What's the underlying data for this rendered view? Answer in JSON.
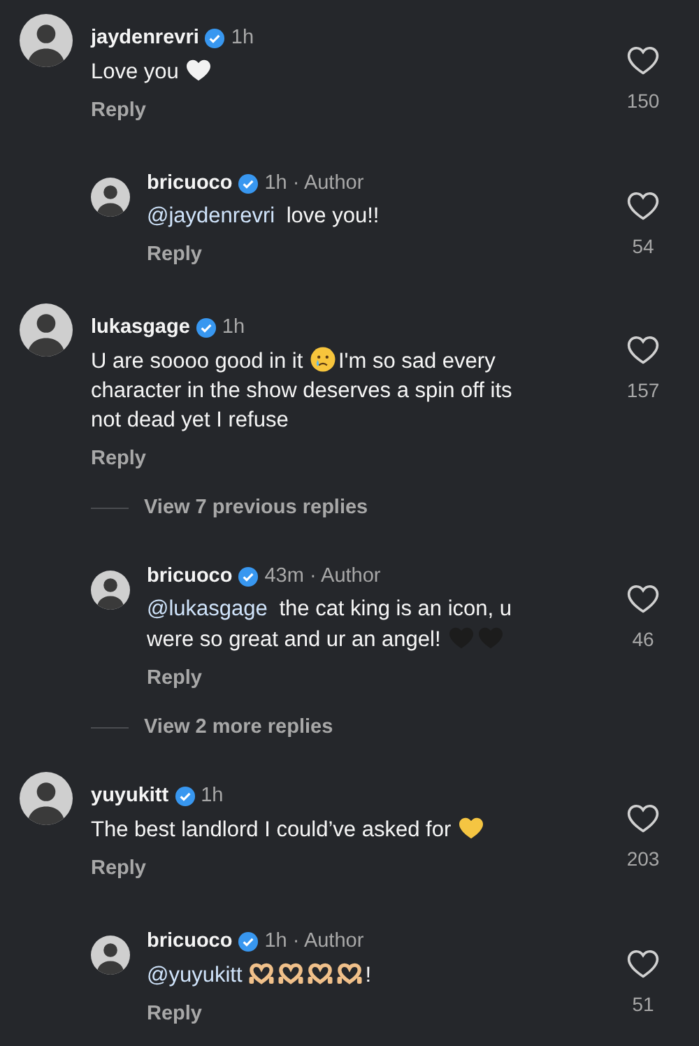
{
  "items": [
    {
      "kind": "comment",
      "username": "jaydenrevri",
      "verified": true,
      "meta": "1h",
      "lines": [
        [
          {
            "kind": "text",
            "text": "Love you "
          },
          {
            "kind": "heart",
            "color": "#f2f2f2"
          }
        ]
      ],
      "reply": "Reply",
      "likes": "150"
    },
    {
      "kind": "reply",
      "username": "bricuoco",
      "verified": true,
      "meta": "1h · Author",
      "lines": [
        [
          {
            "kind": "mention",
            "text": "@jaydenrevri"
          },
          {
            "kind": "text",
            "text": " love you!!"
          }
        ]
      ],
      "reply": "Reply",
      "likes": "54"
    },
    {
      "kind": "comment",
      "username": "lukasgage",
      "verified": true,
      "meta": "1h",
      "lines": [
        [
          {
            "kind": "text",
            "text": "U are soooo good in it "
          },
          {
            "kind": "crying-face"
          },
          {
            "kind": "text",
            "text": "I'm so sad every"
          }
        ],
        [
          {
            "kind": "text",
            "text": "character in the show deserves a spin off its"
          }
        ],
        [
          {
            "kind": "text",
            "text": "not dead yet I refuse"
          }
        ]
      ],
      "reply": "Reply",
      "likes": "157"
    },
    {
      "kind": "more",
      "text": "View 7 previous replies"
    },
    {
      "kind": "reply",
      "username": "bricuoco",
      "verified": true,
      "meta": "43m · Author",
      "lines": [
        [
          {
            "kind": "mention",
            "text": "@lukasgage"
          },
          {
            "kind": "text",
            "text": " the cat king is an icon, u"
          }
        ],
        [
          {
            "kind": "text",
            "text": "were so great and ur an angel! "
          },
          {
            "kind": "heart",
            "color": "#1c1c1c"
          },
          {
            "kind": "heart",
            "color": "#1c1c1c"
          }
        ]
      ],
      "reply": "Reply",
      "likes": "46"
    },
    {
      "kind": "more",
      "text": "View 2 more replies"
    },
    {
      "kind": "comment",
      "username": "yuyukitt",
      "verified": true,
      "meta": "1h",
      "lines": [
        [
          {
            "kind": "text",
            "text": "The best landlord I could’ve asked for "
          },
          {
            "kind": "heart",
            "color": "#f5c542"
          }
        ]
      ],
      "reply": "Reply",
      "likes": "203"
    },
    {
      "kind": "reply",
      "username": "bricuoco",
      "verified": true,
      "meta": "1h · Author",
      "lines": [
        [
          {
            "kind": "mention",
            "text": "@yuyukitt"
          },
          {
            "kind": "heart-hands"
          },
          {
            "kind": "heart-hands"
          },
          {
            "kind": "heart-hands"
          },
          {
            "kind": "heart-hands"
          },
          {
            "kind": "text",
            "text": "!"
          }
        ]
      ],
      "reply": "Reply",
      "likes": "51"
    }
  ]
}
